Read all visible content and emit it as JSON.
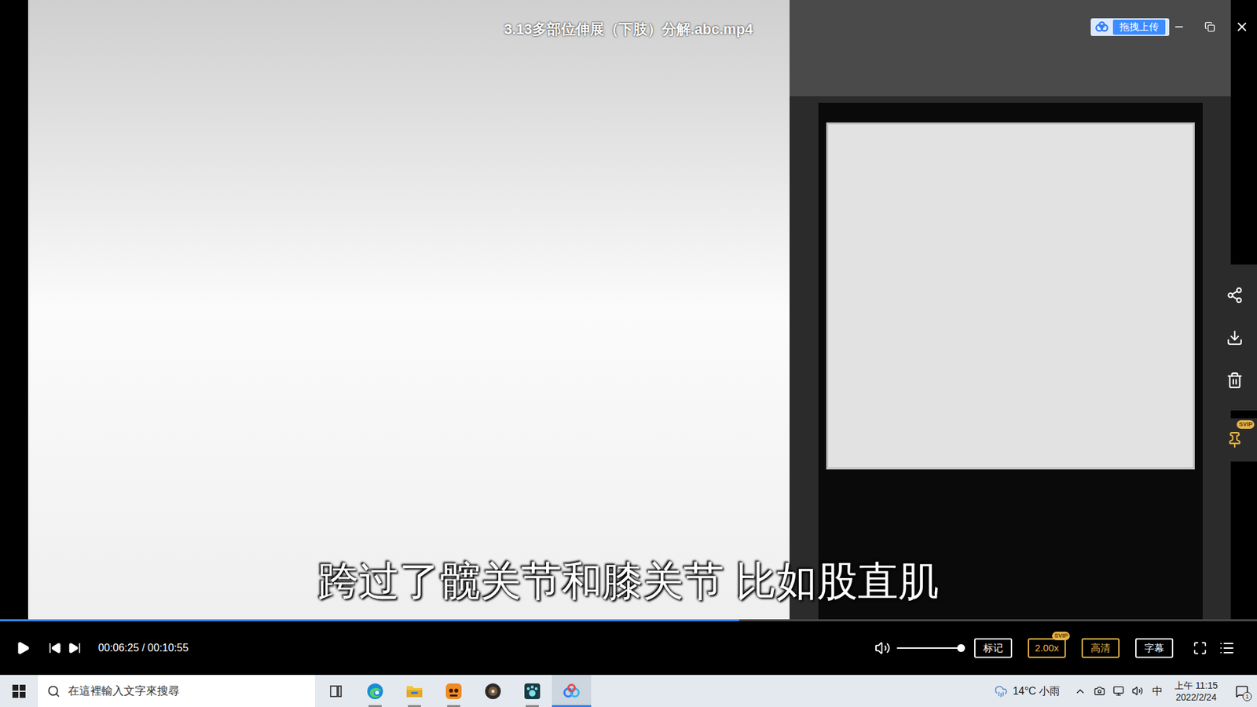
{
  "window": {
    "title": "3.13多部位伸展（下肢）分解.abc.mp4",
    "upload_button": "拖拽上传"
  },
  "subtitle": "跨过了髋关节和膝关节 比如股直肌",
  "playback": {
    "playing": false,
    "progress": 0.588,
    "time": "00:06:25 / 00:10:55",
    "volume": 1.0
  },
  "control_buttons": [
    {
      "label": "标记",
      "highlighted": false
    },
    {
      "label": "2.00x",
      "highlighted": true,
      "badge": "SVIP"
    },
    {
      "label": "高清",
      "highlighted": true
    },
    {
      "label": "字幕",
      "highlighted": false
    }
  ],
  "side_toolbar": {
    "pin_badge": "SVIP"
  },
  "taskbar": {
    "search_placeholder": "在這裡輸入文字來搜尋",
    "apps": [
      {
        "kind": "task-view",
        "running": false,
        "active": false
      },
      {
        "kind": "edge",
        "running": true,
        "active": false
      },
      {
        "kind": "explorer",
        "running": true,
        "active": false
      },
      {
        "kind": "orange-app",
        "running": true,
        "active": false
      },
      {
        "kind": "disc-app",
        "running": false,
        "active": false
      },
      {
        "kind": "teal-app",
        "running": true,
        "active": false
      },
      {
        "kind": "netdisk",
        "running": true,
        "active": true
      }
    ]
  },
  "tray": {
    "weather": "14°C 小雨",
    "ime": "中",
    "time": "上午 11:15",
    "date": "2022/2/24",
    "notifications": "1"
  }
}
